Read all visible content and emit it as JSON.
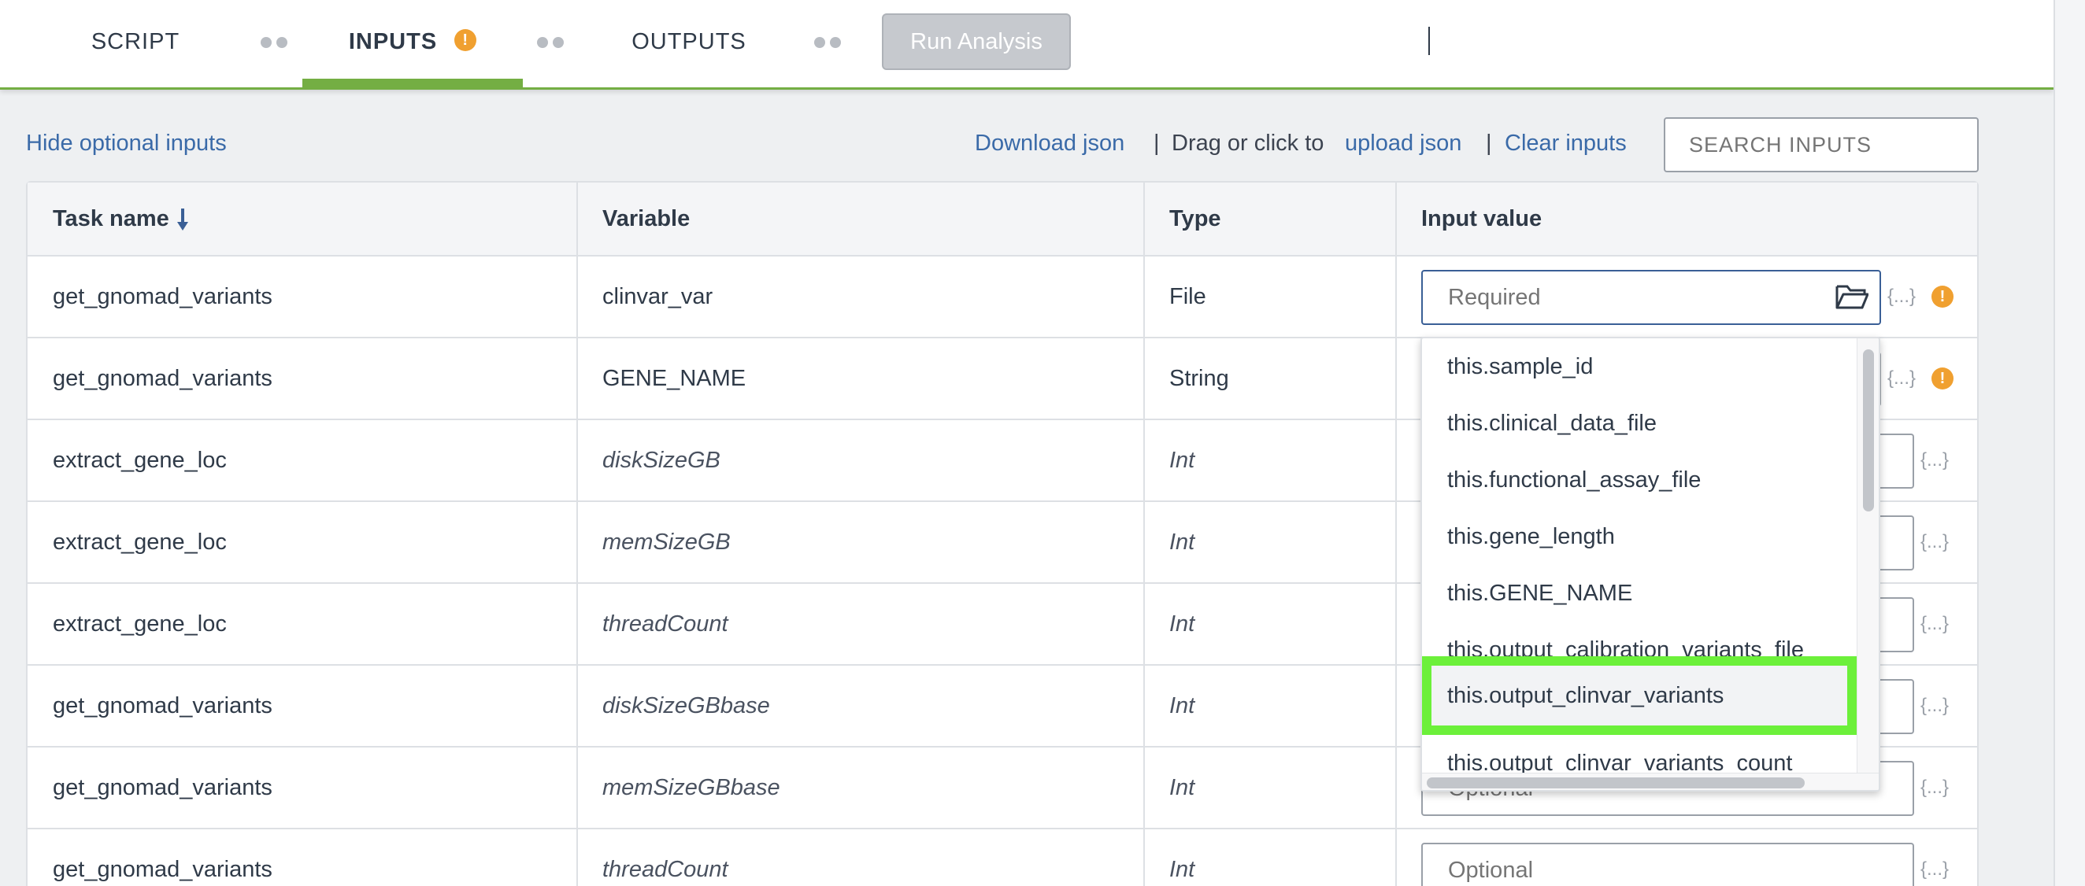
{
  "header": {
    "tabs": [
      {
        "label": "SCRIPT"
      },
      {
        "label": "INPUTS",
        "badge": "!"
      },
      {
        "label": "OUTPUTS"
      }
    ],
    "run_button": "Run Analysis"
  },
  "toolbar": {
    "hide_optional": "Hide optional inputs",
    "download_json": "Download json",
    "separator": "|",
    "drag_text": "Drag or click to",
    "upload_json": "upload json",
    "clear_inputs": "Clear inputs",
    "search_placeholder": "SEARCH INPUTS"
  },
  "table": {
    "headers": {
      "task": "Task name",
      "variable": "Variable",
      "type": "Type",
      "value": "Input value"
    },
    "json_icon": "{...}",
    "warn_badge": "!",
    "rows": [
      {
        "task": "get_gnomad_variants",
        "variable": "clinvar_var",
        "type": "File",
        "placeholder": "Required"
      },
      {
        "task": "get_gnomad_variants",
        "variable": "GENE_NAME",
        "type": "String"
      },
      {
        "task": "extract_gene_loc",
        "variable": "diskSizeGB",
        "type": "Int"
      },
      {
        "task": "extract_gene_loc",
        "variable": "memSizeGB",
        "type": "Int"
      },
      {
        "task": "extract_gene_loc",
        "variable": "threadCount",
        "type": "Int"
      },
      {
        "task": "get_gnomad_variants",
        "variable": "diskSizeGBbase",
        "type": "Int"
      },
      {
        "task": "get_gnomad_variants",
        "variable": "memSizeGBbase",
        "type": "Int",
        "placeholder": "Optional"
      },
      {
        "task": "get_gnomad_variants",
        "variable": "threadCount",
        "type": "Int",
        "placeholder": "Optional"
      }
    ]
  },
  "dropdown": {
    "items": [
      "this.sample_id",
      "this.clinical_data_file",
      "this.functional_assay_file",
      "this.gene_length",
      "this.GENE_NAME",
      "this.output_calibration_variants_file",
      "this.output_clinvar_variants",
      "this.output_clinvar_variants_count"
    ],
    "highlighted_index": 6
  },
  "colors": {
    "accent_green": "#74ae43",
    "link_blue": "#3a6aa8",
    "warning_orange": "#f0a030",
    "highlight_green": "#6cf03a"
  }
}
